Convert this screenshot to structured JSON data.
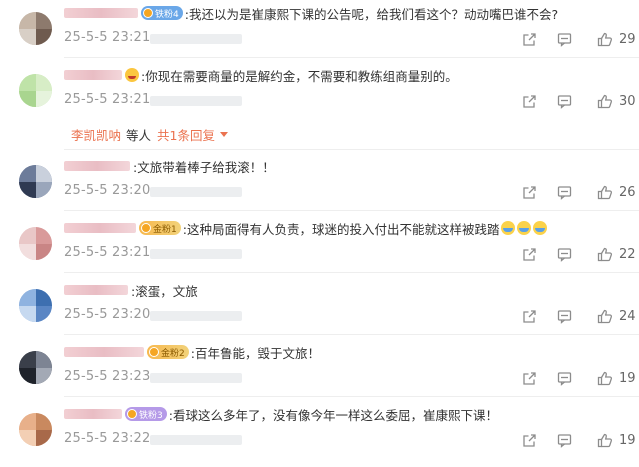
{
  "colors": {
    "link": "#eb7350",
    "meta": "#999999",
    "icon": "#8c8c8c"
  },
  "comments": [
    {
      "badge": "铁粉4",
      "badge_style": "blue",
      "text": ":我还以为是崔康熙下课的公告呢，给我们看这个？动动嘴巴谁不会?",
      "time": "25-5-5 23:21",
      "likes": "29",
      "avatar": [
        "#c7b7a8",
        "#8d7a6d",
        "#d8cfc6",
        "#6f5b4f"
      ]
    },
    {
      "badge": "",
      "badge_style": "face",
      "text": ":你现在需要商量的是解约金，不需要和教练组商量别的。",
      "time": "25-5-5 23:21",
      "likes": "30",
      "avatar": [
        "#bfe3a8",
        "#d7edc6",
        "#a9d58f",
        "#e6f3dc"
      ],
      "replies": {
        "name": "李凯凯呐",
        "suffix": "等人",
        "count": "共1条回复"
      }
    },
    {
      "badge": "",
      "badge_style": "none",
      "text": ":文旅带着棒子给我滚！！",
      "time": "25-5-5 23:20",
      "likes": "26",
      "avatar": [
        "#6d7c9a",
        "#c9d0dc",
        "#2f3a52",
        "#9aa6bb"
      ]
    },
    {
      "badge": "金粉1",
      "badge_style": "gold",
      "text": ":这种局面得有人负责，球迷的投入付出不能就这样被践踏",
      "time": "25-5-5 23:21",
      "likes": "22",
      "avatar": [
        "#e9c7c7",
        "#d99a9a",
        "#f2dede",
        "#c98585"
      ]
    },
    {
      "badge": "",
      "badge_style": "none",
      "text": ":滚蛋，文旅",
      "time": "25-5-5 23:20",
      "likes": "24",
      "avatar": [
        "#8fb3e0",
        "#3d6fb0",
        "#c6d9f0",
        "#5a86c4"
      ]
    },
    {
      "badge": "金粉2",
      "badge_style": "gold",
      "text": ":百年鲁能，毁于文旅！",
      "time": "25-5-5 23:23",
      "likes": "19",
      "avatar": [
        "#3a3f4a",
        "#7d8493",
        "#1f232b",
        "#a3a9b5"
      ]
    },
    {
      "badge": "铁粉3",
      "badge_style": "purple",
      "text": ":看球这么多年了，没有像今年一样这么委屈，崔康熙下课！",
      "time": "25-5-5 23:22",
      "likes": "19",
      "avatar": [
        "#e8b08a",
        "#c9895f",
        "#f3cfb4",
        "#a8694a"
      ]
    }
  ]
}
